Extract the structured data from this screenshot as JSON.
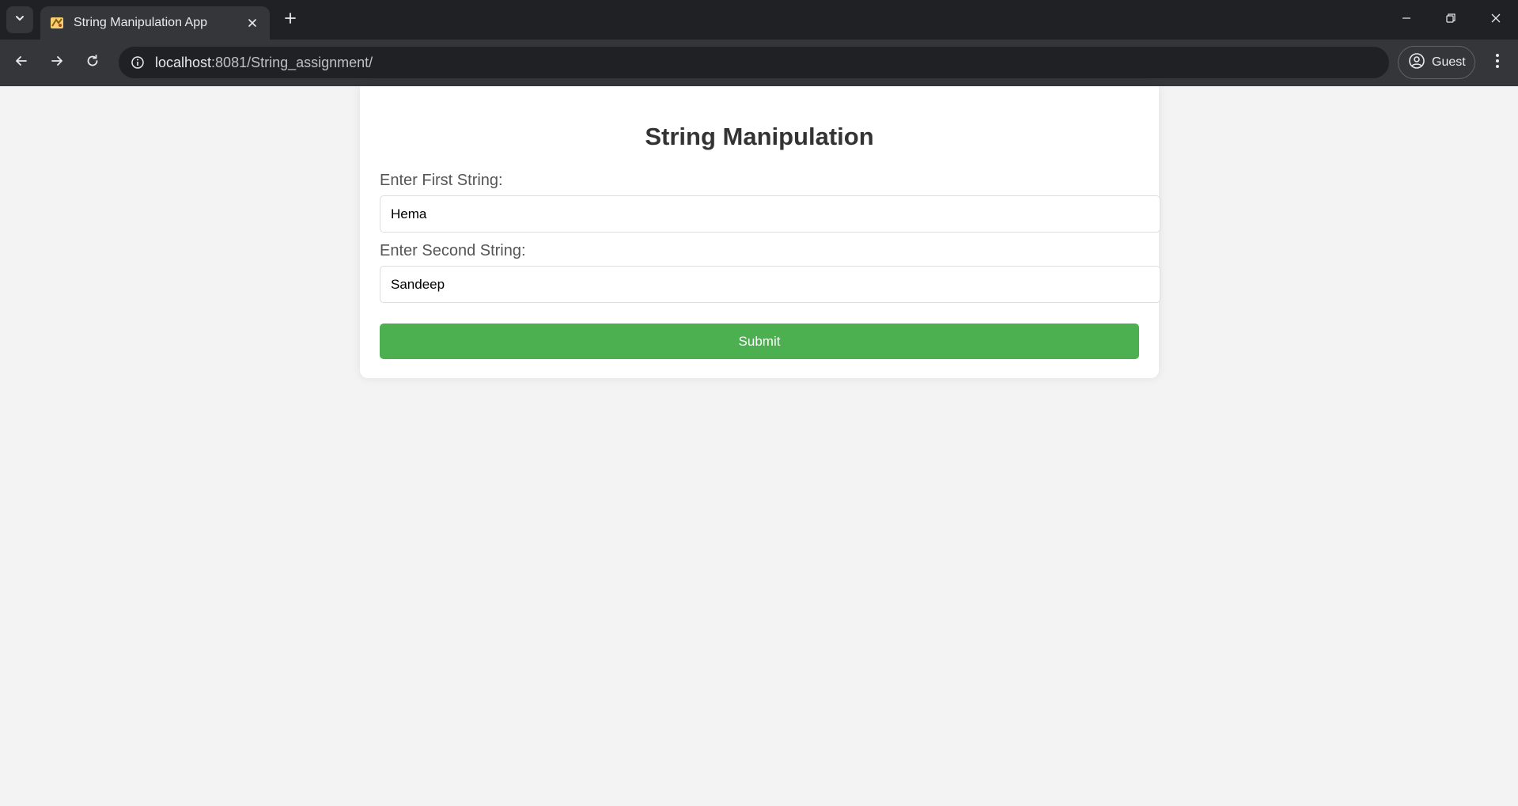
{
  "browser": {
    "tab": {
      "title": "String Manipulation App"
    },
    "address_bar": {
      "host": "localhost",
      "rest": ":8081/String_assignment/"
    },
    "profile": {
      "label": "Guest"
    }
  },
  "page": {
    "title": "String Manipulation",
    "first_string": {
      "label": "Enter First String:",
      "value": "Hema"
    },
    "second_string": {
      "label": "Enter Second String:",
      "value": "Sandeep"
    },
    "submit_label": "Submit"
  },
  "colors": {
    "accent_green": "#4caf50",
    "page_background": "#f3f3f3",
    "chrome_dark": "#202124",
    "chrome_toolbar": "#35363a"
  }
}
